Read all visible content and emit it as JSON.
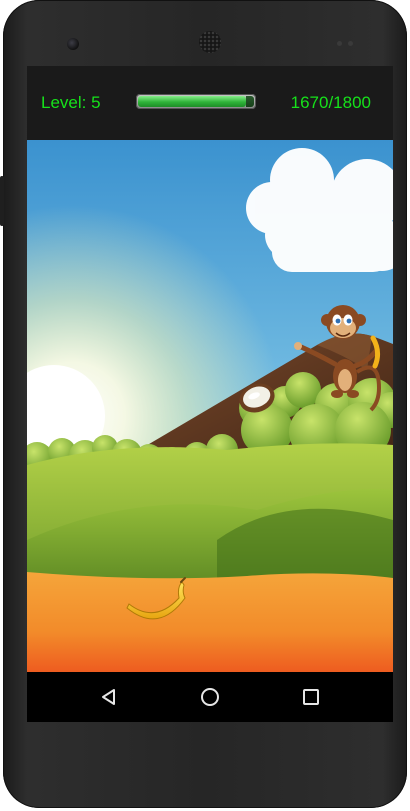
{
  "hud": {
    "level_text": "Level: 5",
    "score_text": "1670/1800",
    "progress": 0.928,
    "text_color": "#16e11a"
  },
  "scene": {
    "icons": [
      "sun",
      "cloud",
      "mountain",
      "monkey",
      "coconut",
      "banana",
      "bushes",
      "hills",
      "ground"
    ]
  },
  "navbar": {
    "icons": [
      "back-icon",
      "home-icon",
      "recents-icon"
    ]
  }
}
